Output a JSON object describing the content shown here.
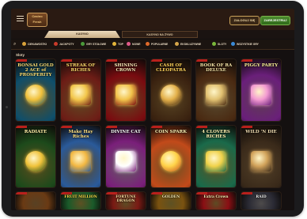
{
  "header": {
    "logo_text": "Casino Fresh",
    "login_label": "ZALOGUJ SIĘ",
    "register_label": "ZAREJESTRUJ"
  },
  "tabs": [
    {
      "label": "KASYNO",
      "active": true
    },
    {
      "label": "KASYNO NA ŻYWO",
      "active": false
    }
  ],
  "categories": [
    {
      "label": "CIEKAWOSTKI",
      "icon": "coin-icon",
      "color": "#d9a23a"
    },
    {
      "label": "JACKPOTY",
      "icon": "jackpot-icon",
      "color": "#c93b2a"
    },
    {
      "label": "GRY STOŁOWE",
      "icon": "cards-icon",
      "color": "#4a9a3a"
    },
    {
      "label": "TOP",
      "icon": "star-icon",
      "color": "#e3b53a"
    },
    {
      "label": "NOWE",
      "icon": "sparkle-icon",
      "color": "#e05a8a"
    },
    {
      "label": "POPULARNE",
      "icon": "fire-icon",
      "color": "#e06a2a"
    },
    {
      "label": "EKSKLUZYWNE",
      "icon": "crown-icon",
      "color": "#d6a64a"
    },
    {
      "label": "SLOTY",
      "icon": "slot-icon",
      "color": "#7ab83a"
    },
    {
      "label": "WSZYSTKIE GRY",
      "icon": "grid-icon",
      "color": "#3a8ad6"
    }
  ],
  "section_title": "Sloty",
  "games": [
    {
      "title": "BONSAI GOLD 2 ACE of PROSPERITY",
      "bg": "#0f4f6b",
      "accent": "#f0c03a",
      "text_color": "#f7dd77"
    },
    {
      "title": "STREAK OF RICHES",
      "bg": "#6d1d16",
      "accent": "#f2c64a",
      "text_color": "#ffd86a"
    },
    {
      "title": "SHINING CROWN",
      "bg": "#7a0c10",
      "accent": "#f1c24a",
      "text_color": "#fbe7b5"
    },
    {
      "title": "CASH OF CLEOPATRA",
      "bg": "#3a2210",
      "accent": "#e3b04a",
      "text_color": "#ffd35a"
    },
    {
      "title": "BOOK OF RA DELUXE",
      "bg": "#4a2a12",
      "accent": "#e0c070",
      "text_color": "#f4e2a4"
    },
    {
      "title": "PIGGY PARTY",
      "bg": "#6a1f7a",
      "accent": "#f39ad1",
      "text_color": "#fff39b"
    },
    {
      "title": "RADIATE",
      "bg": "#1d4a1b",
      "accent": "#f0c23a",
      "text_color": "#fff2a8"
    },
    {
      "title": "Make Hay Riches",
      "bg": "#2a5a9a",
      "accent": "#f2b742",
      "text_color": "#ffe48a"
    },
    {
      "title": "DIVINE CAT",
      "bg": "#7a1f7a",
      "accent": "#ffffff",
      "text_color": "#ffffff"
    },
    {
      "title": "COIN SPARK",
      "bg": "#c24a1a",
      "accent": "#ffd34a",
      "text_color": "#fff1b3"
    },
    {
      "title": "4 CLOVERS RICHES",
      "bg": "#1a6a4a",
      "accent": "#f0d24a",
      "text_color": "#fff5b3"
    },
    {
      "title": "WILD 'N DIE",
      "bg": "#3a2a1a",
      "accent": "#d1a25a",
      "text_color": "#f1ddb1"
    },
    {
      "title": "",
      "bg": "#6a3a14",
      "accent": "#e0a24a",
      "text_color": "#ffe0a0"
    },
    {
      "title": "FRUIT MILLION",
      "bg": "#1a5a2a",
      "accent": "#f0d24a",
      "text_color": "#ffe34a"
    },
    {
      "title": "FORTUNE DRAGON",
      "bg": "#7a1a14",
      "accent": "#f0c24a",
      "text_color": "#ffe0a0"
    },
    {
      "title": "GOLDEN",
      "bg": "#7a5210",
      "accent": "#f0d24a",
      "text_color": "#fff1b3"
    },
    {
      "title": "Extra Crown",
      "bg": "#8a0f14",
      "accent": "#f0c24a",
      "text_color": "#fff1b3"
    },
    {
      "title": "RAID",
      "bg": "#2a2a34",
      "accent": "#c0c0c0",
      "text_color": "#f4f4f4"
    }
  ]
}
